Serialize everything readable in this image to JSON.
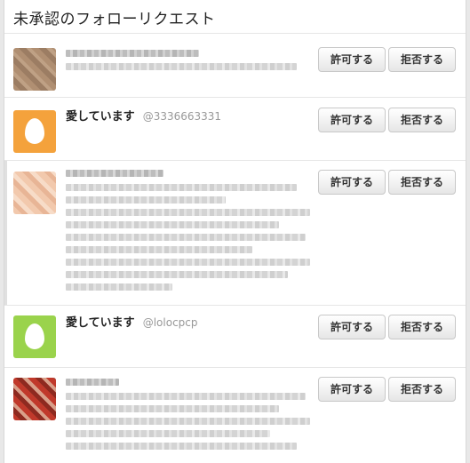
{
  "header": {
    "title": "未承認のフォローリクエスト"
  },
  "buttons": {
    "allow_label": "許可する",
    "deny_label": "拒否する"
  },
  "requests": [
    {
      "name": "",
      "handle": "",
      "avatar_color": "#a98a6e"
    },
    {
      "name": "愛しています",
      "handle": "@3336663331",
      "avatar_color": "#f4a23c"
    },
    {
      "name": "",
      "handle": "",
      "avatar_color": "#f2c9ad"
    },
    {
      "name": "愛しています",
      "handle": "@lolocpcp",
      "avatar_color": "#9ad34c"
    },
    {
      "name": "",
      "handle": "",
      "avatar_color": "#c0392b"
    }
  ]
}
